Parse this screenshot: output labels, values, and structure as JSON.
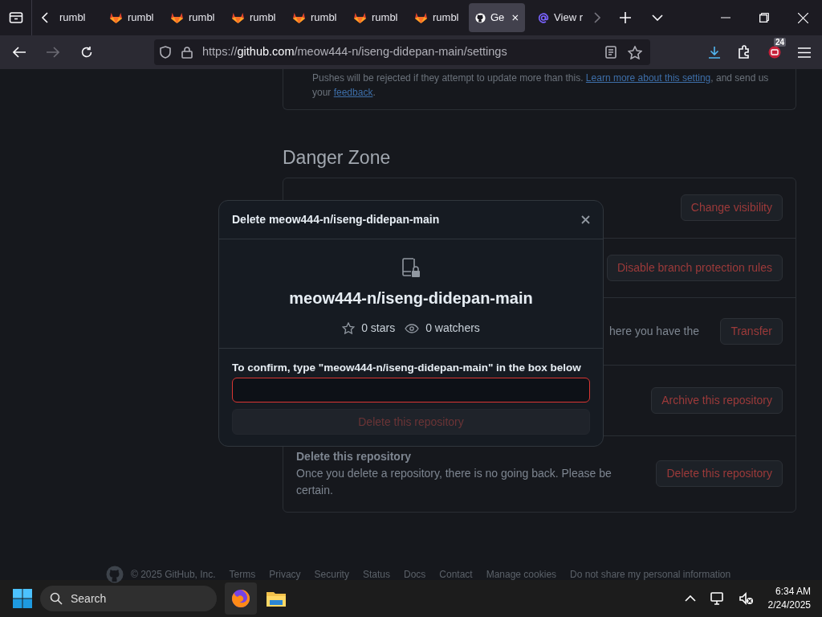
{
  "browser": {
    "tabs": [
      {
        "label": "rumbl",
        "kind": "plain",
        "selected": false
      },
      {
        "label": "rumbl",
        "kind": "gitlab",
        "selected": false
      },
      {
        "label": "rumbl",
        "kind": "gitlab",
        "selected": false
      },
      {
        "label": "rumbl",
        "kind": "gitlab",
        "selected": false
      },
      {
        "label": "rumbl",
        "kind": "gitlab",
        "selected": false
      },
      {
        "label": "rumbl",
        "kind": "gitlab",
        "selected": false
      },
      {
        "label": "rumbl",
        "kind": "gitlab",
        "selected": false
      },
      {
        "label": "Ge",
        "kind": "github",
        "selected": true
      },
      {
        "label": "View r",
        "kind": "mail",
        "selected": false
      }
    ],
    "url_prefix": "https://",
    "url_host": "github.com",
    "url_path": "/meow444-n/iseng-didepan-main/settings",
    "extension_badge": "24"
  },
  "page": {
    "push_note": [
      {
        "text": "Pushes will be rejected if they attempt to update more than this. ",
        "link": false
      },
      {
        "text": "Learn more about this setting",
        "link": true
      },
      {
        "text": ", and send us your ",
        "link": false
      },
      {
        "text": "feedback",
        "link": true
      },
      {
        "text": ".",
        "link": false
      }
    ],
    "danger_zone": {
      "title": "Danger Zone",
      "rows": [
        {
          "button": "Change visibility"
        },
        {
          "button": "Disable branch protection rules"
        },
        {
          "fragment": "here you have the",
          "button": "Transfer"
        },
        {
          "button": "Archive this repository"
        },
        {
          "title": "Delete this repository",
          "description": "Once you delete a repository, there is no going back. Please be certain.",
          "button": "Delete this repository"
        }
      ]
    },
    "footer": {
      "copyright": "© 2025 GitHub, Inc.",
      "links": [
        "Terms",
        "Privacy",
        "Security",
        "Status",
        "Docs",
        "Contact",
        "Manage cookies",
        "Do not share my personal information"
      ]
    }
  },
  "modal": {
    "title": "Delete meow444-n/iseng-didepan-main",
    "repo": "meow444-n/iseng-didepan-main",
    "stars": "0 stars",
    "watchers": "0 watchers",
    "confirm_label": "To confirm, type \"meow444-n/iseng-didepan-main\" in the box below",
    "input_invalid": true,
    "button": "Delete this repository",
    "button_disabled": true
  },
  "taskbar": {
    "search_placeholder": "Search",
    "time": "6:34 AM",
    "date": "2/24/2025"
  }
}
